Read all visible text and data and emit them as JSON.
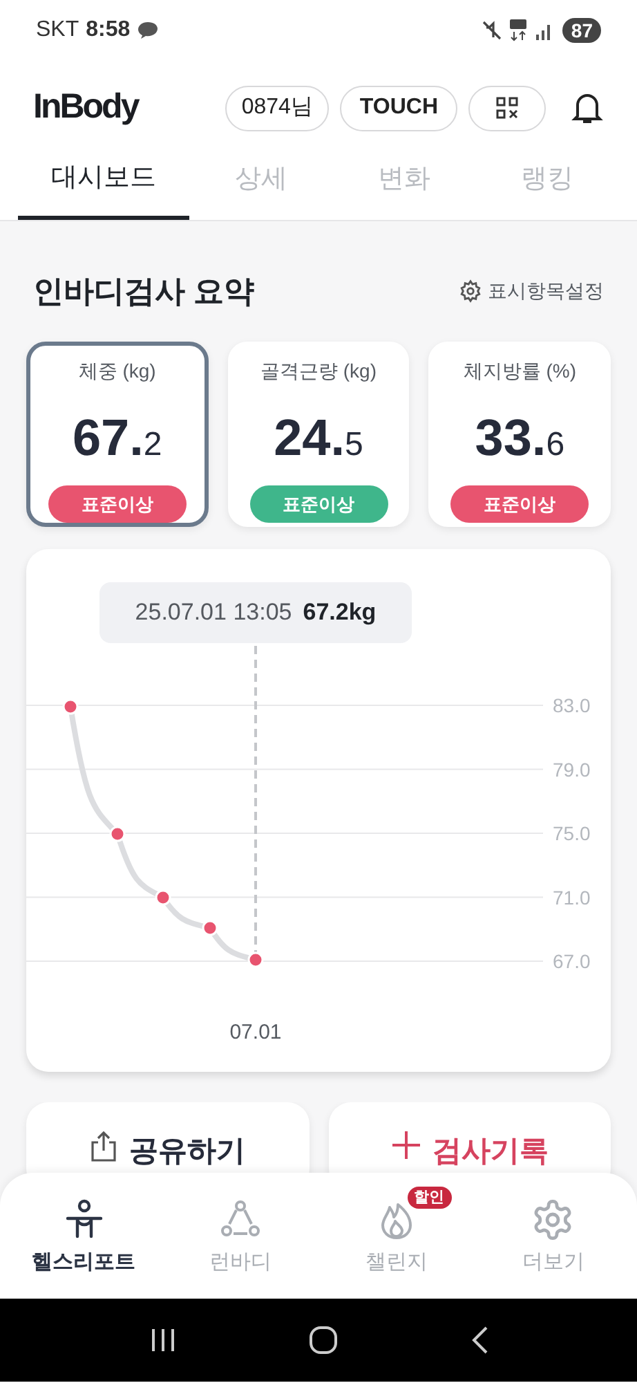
{
  "status_bar": {
    "carrier": "SKT",
    "time": "8:58",
    "battery": "87"
  },
  "header": {
    "logo": "InBody",
    "user_chip": "0874님",
    "touch_button": "TOUCH"
  },
  "tabs": [
    {
      "label": "대시보드",
      "selected": true
    },
    {
      "label": "상세",
      "selected": false
    },
    {
      "label": "변화",
      "selected": false
    },
    {
      "label": "랭킹",
      "selected": false
    }
  ],
  "summary": {
    "title": "인바디검사 요약",
    "settings_link": "표시항목설정",
    "cards": [
      {
        "label": "체중 (kg)",
        "value": "67.2",
        "status": "표준이상",
        "color": "#e8546f",
        "selected": true
      },
      {
        "label": "골격근량 (kg)",
        "value": "24.5",
        "status": "표준이상",
        "color": "#3fb68b",
        "selected": false
      },
      {
        "label": "체지방률 (%)",
        "value": "33.6",
        "status": "표준이상",
        "color": "#e8546f",
        "selected": false
      }
    ]
  },
  "trend": {
    "tooltip": {
      "time": "25.07.01 13:05",
      "value": "67.2kg"
    },
    "scale_labels": [
      "83.0",
      "79.0",
      "75.0",
      "71.0",
      "67.0"
    ],
    "date_label": "07.01"
  },
  "actions": [
    {
      "kind": "share",
      "label": "공유하기"
    },
    {
      "kind": "add",
      "label": "검사기록"
    }
  ],
  "bottom_nav": [
    {
      "kind": "health",
      "label": "헬스리포트",
      "selected": true
    },
    {
      "kind": "run",
      "label": "런바디",
      "selected": false
    },
    {
      "kind": "challenge",
      "label": "챌린지",
      "selected": false,
      "badge": "할인"
    },
    {
      "kind": "more",
      "label": "더보기",
      "selected": false
    }
  ]
}
